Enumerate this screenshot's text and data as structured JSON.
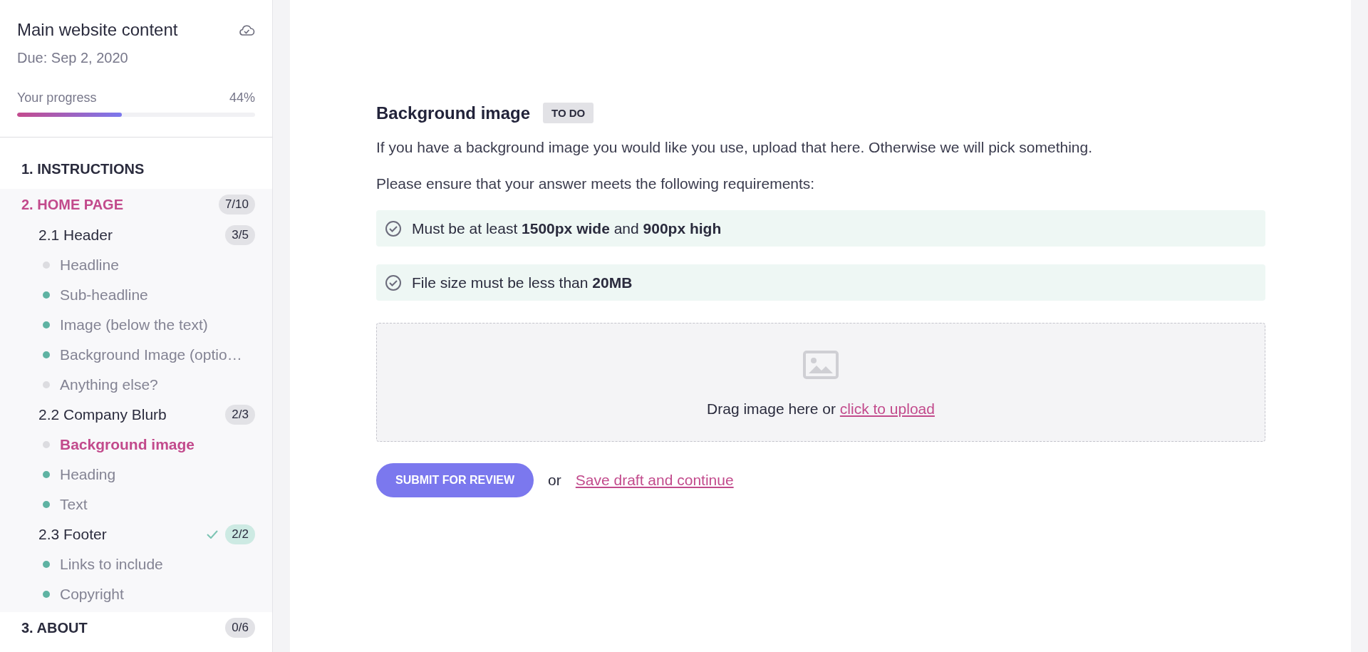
{
  "sidebar": {
    "title": "Main website content",
    "due": "Due: Sep 2, 2020",
    "saved": true,
    "progress": {
      "label": "Your progress",
      "reading": "44%",
      "level": 0.44
    },
    "sections": [
      {
        "label": "1. INSTRUCTIONS",
        "selected": false
      },
      {
        "label": "2. HOME PAGE",
        "count": "7/10",
        "selected": true,
        "children": [
          {
            "label": "2.1 Header",
            "count": "3/5",
            "complete": false,
            "children": [
              {
                "label": "Headline",
                "done": false,
                "selected": false
              },
              {
                "label": "Sub-headline",
                "done": true,
                "selected": false
              },
              {
                "label": "Image (below the text)",
                "done": true,
                "selected": false
              },
              {
                "label": "Background Image (optio…",
                "done": true,
                "selected": false
              },
              {
                "label": "Anything else?",
                "done": false,
                "selected": false
              }
            ]
          },
          {
            "label": "2.2 Company Blurb",
            "count": "2/3",
            "complete": false,
            "children": [
              {
                "label": "Background image",
                "done": false,
                "selected": true
              },
              {
                "label": "Heading",
                "done": true,
                "selected": false
              },
              {
                "label": "Text",
                "done": true,
                "selected": false
              }
            ]
          },
          {
            "label": "2.3 Footer",
            "count": "2/2",
            "complete": true,
            "children": [
              {
                "label": "Links to include",
                "done": true,
                "selected": false
              },
              {
                "label": "Copyright",
                "done": true,
                "selected": false
              }
            ]
          }
        ]
      },
      {
        "label": "3. ABOUT",
        "count": "0/6",
        "selected": false
      }
    ]
  },
  "main": {
    "heading": "Background image",
    "status": "TO DO",
    "description": "If you have a background image you would like you use, upload that here. Otherwise we will pick something.",
    "requirements_intro": "Please ensure that your answer meets the following requirements:",
    "requirements": [
      {
        "text": "Must be at least **1500px wide** and **900px high**"
      },
      {
        "text": "File size must be less than **20MB**"
      }
    ],
    "dropzone": {
      "text": "Drag image here or",
      "link": "click to upload"
    },
    "submit": "SUBMIT FOR REVIEW",
    "separator": "or",
    "save_link": "Save draft and continue"
  }
}
